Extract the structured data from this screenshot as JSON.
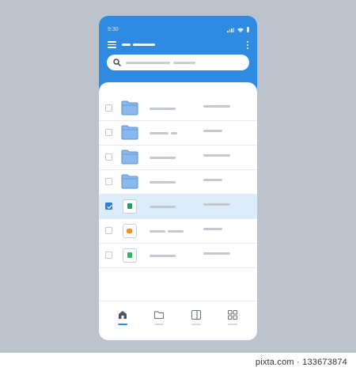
{
  "status_bar": {
    "time": "9:30"
  },
  "header": {
    "accent_color": "#2f8ae2"
  },
  "search": {
    "placeholder": ""
  },
  "file_list": {
    "items": [
      {
        "type": "folder",
        "checked": false,
        "selected": false
      },
      {
        "type": "folder",
        "checked": false,
        "selected": false
      },
      {
        "type": "folder",
        "checked": false,
        "selected": false
      },
      {
        "type": "folder",
        "checked": false,
        "selected": false
      },
      {
        "type": "file",
        "file_color": "#1f9e6d",
        "checked": true,
        "selected": true
      },
      {
        "type": "file",
        "file_color": "#f0922b",
        "checked": false,
        "selected": false
      },
      {
        "type": "file",
        "file_color": "#2fb36b",
        "checked": false,
        "selected": false
      }
    ]
  },
  "bottom_nav": {
    "items": [
      {
        "icon": "home-icon",
        "active": true
      },
      {
        "icon": "folder-icon",
        "active": false
      },
      {
        "icon": "panel-icon",
        "active": false
      },
      {
        "icon": "grid-icon",
        "active": false
      }
    ]
  },
  "watermark": {
    "text": "pixta.com · 133673874"
  }
}
